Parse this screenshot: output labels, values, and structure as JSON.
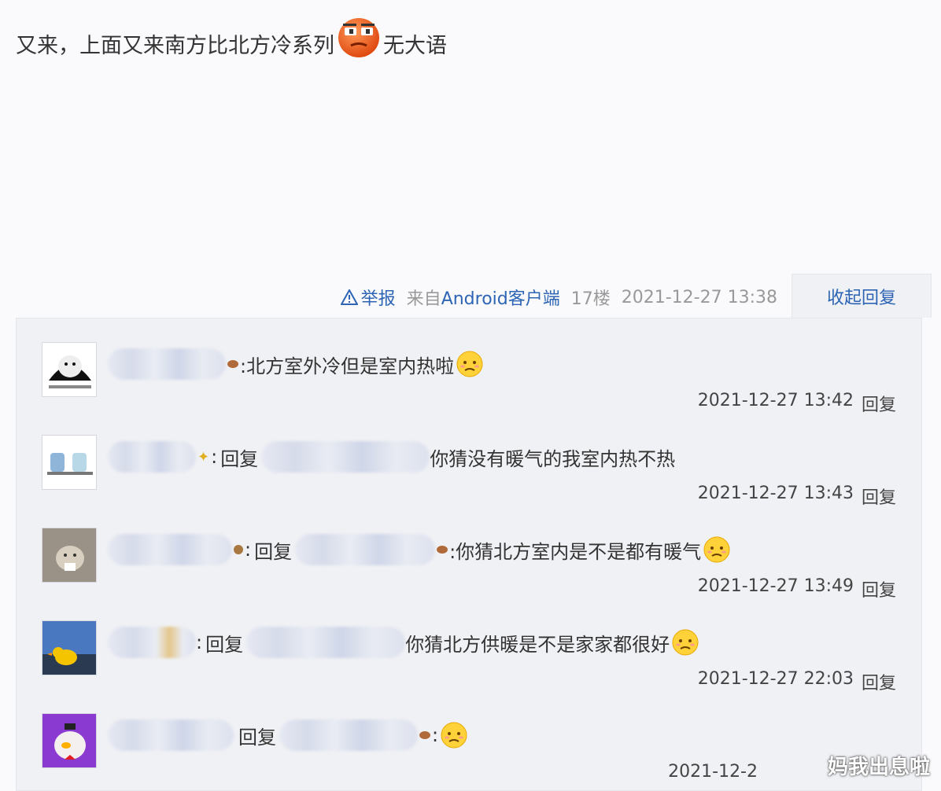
{
  "post": {
    "text_before": "又来，上面又来南方比北方冷系列",
    "text_after": "无大语",
    "emoji": "angry-face-icon"
  },
  "meta": {
    "report": "举报",
    "source_label": "来自",
    "source_client": "Android客户端",
    "floor": "17楼",
    "time": "2021-12-27 13:38",
    "collapse": "收起回复"
  },
  "replies": [
    {
      "name_hidden": true,
      "text": ":北方室外冷但是室内热啦",
      "time": "2021-12-27 13:42",
      "reply_label": "回复",
      "avatar_icon": "panda-meme-avatar"
    },
    {
      "name_hidden": true,
      "reply_kw": "回复",
      "text": "你猜没有暖气的我室内热不热",
      "time": "2021-12-27 13:43",
      "reply_label": "回复",
      "avatar_icon": "cartoon-avatar"
    },
    {
      "name_hidden": true,
      "reply_kw": "回复",
      "text": ":你猜北方室内是不是都有暖气",
      "time": "2021-12-27 13:49",
      "reply_label": "回复",
      "avatar_icon": "cat-avatar"
    },
    {
      "name_hidden": true,
      "reply_kw": "回复",
      "text": "你猜北方供暖是不是家家都很好",
      "time": "2021-12-27 22:03",
      "reply_label": "回复",
      "avatar_icon": "duck-avatar"
    },
    {
      "name_hidden": true,
      "reply_kw": "回复",
      "text": ":",
      "time": "2021-12-2",
      "reply_label": "",
      "avatar_icon": "purple-cat-avatar"
    }
  ],
  "watermark": "妈我出息啦"
}
